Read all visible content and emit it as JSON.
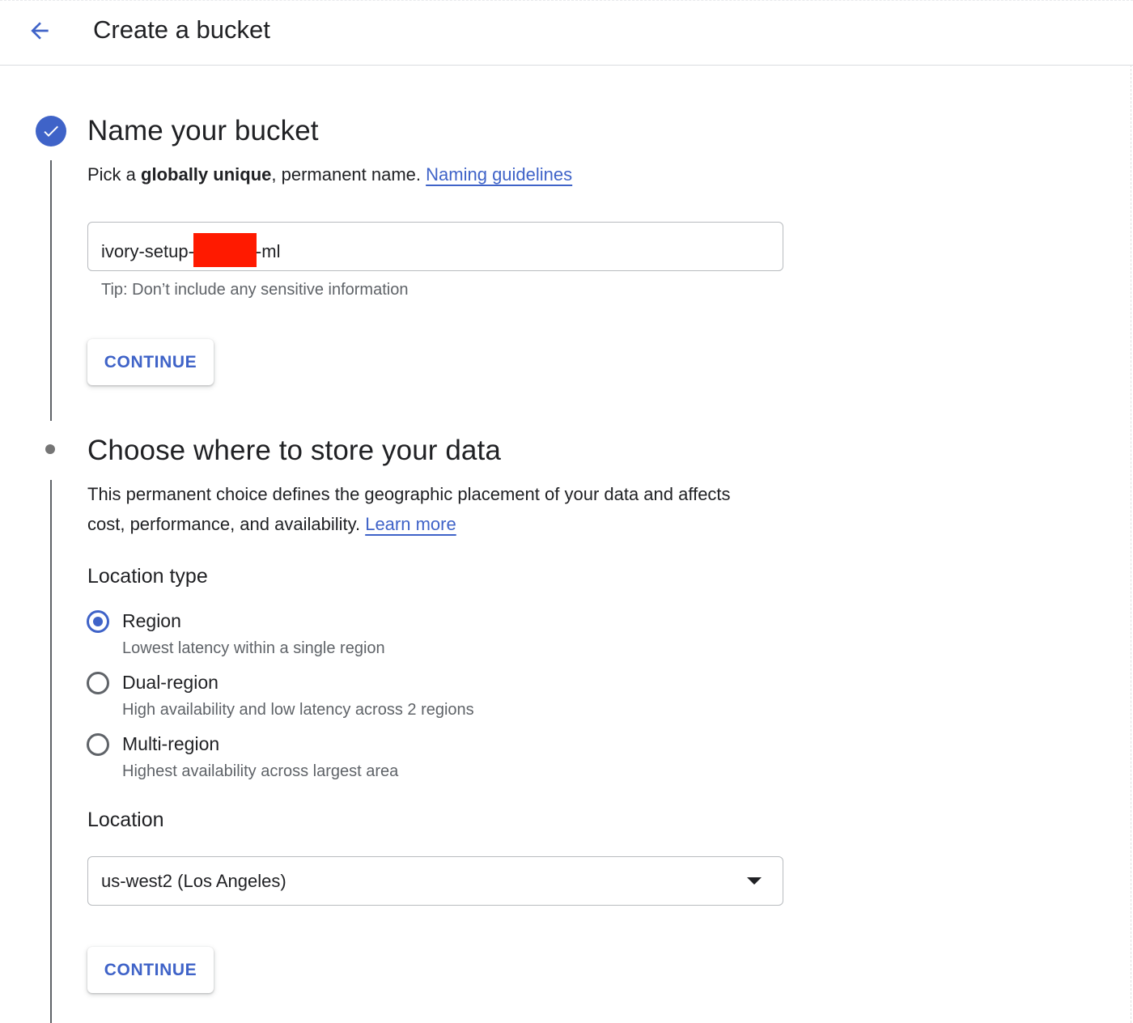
{
  "header": {
    "title": "Create a bucket"
  },
  "step1": {
    "heading": "Name your bucket",
    "desc_prefix": "Pick a ",
    "desc_bold": "globally unique",
    "desc_suffix": ", permanent name. ",
    "link": "Naming guidelines",
    "field_value_prefix": "ivory-setup-",
    "field_value_suffix": "-ml",
    "hint": "Tip: Don’t include any sensitive information",
    "continue_label": "CONTINUE"
  },
  "step2": {
    "heading": "Choose where to store your data",
    "desc_line1": "This permanent choice defines the geographic placement of your data and affects",
    "desc_line2": "cost, performance, and availability. ",
    "link": "Learn more",
    "location_type_label": "Location type",
    "options": [
      {
        "label": "Region",
        "desc": "Lowest latency within a single region",
        "checked": true
      },
      {
        "label": "Dual-region",
        "desc": "High availability and low latency across 2 regions",
        "checked": false
      },
      {
        "label": "Multi-region",
        "desc": "Highest availability across largest area",
        "checked": false
      }
    ],
    "location_label": "Location",
    "location_value": "us-west2 (Los Angeles)",
    "continue_label": "CONTINUE"
  },
  "colors": {
    "accent": "#3f63c8",
    "redaction": "#ff1a00"
  },
  "icons": {
    "back": "arrow-back-icon",
    "step_done": "check-circle-icon",
    "dropdown": "arrow-drop-down-icon"
  }
}
